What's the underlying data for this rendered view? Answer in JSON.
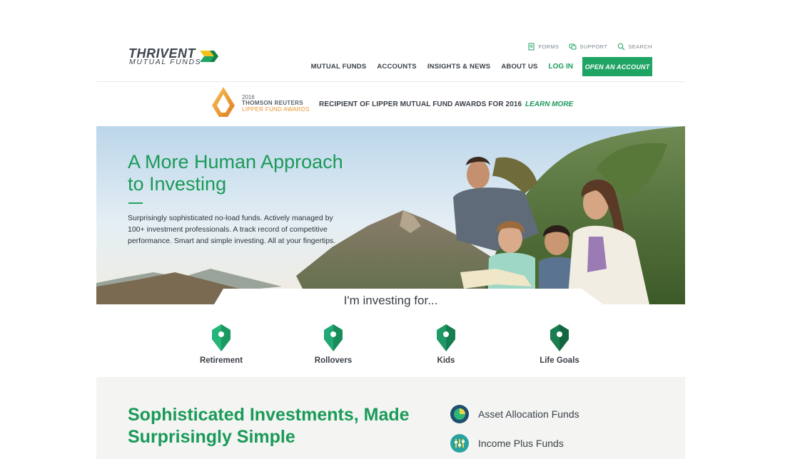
{
  "brand": {
    "name": "THRIVENT",
    "sub": "MUTUAL FUNDS"
  },
  "utility": [
    {
      "label": "FORMS",
      "icon": "document-icon"
    },
    {
      "label": "SUPPORT",
      "icon": "chat-icon"
    },
    {
      "label": "SEARCH",
      "icon": "search-icon"
    }
  ],
  "nav": {
    "items": [
      "MUTUAL FUNDS",
      "ACCOUNTS",
      "INSIGHTS & NEWS",
      "ABOUT US"
    ],
    "login": "LOG IN",
    "cta": "OPEN AN ACCOUNT"
  },
  "award": {
    "year": "2016",
    "org": "THOMSON REUTERS",
    "name": "LIPPER FUND AWARDS",
    "text": "RECIPIENT OF LIPPER MUTUAL FUND AWARDS FOR 2016",
    "link": "LEARN MORE"
  },
  "hero": {
    "title": "A More Human Approach to Investing",
    "body": "Surprisingly sophisticated no-load funds. Actively managed by 100+ investment professionals. A track record of competitive performance. Smart and simple investing. All at your fingertips."
  },
  "investing": {
    "title": "I'm investing for...",
    "goals": [
      "Retirement",
      "Rollovers",
      "Kids",
      "Life Goals"
    ]
  },
  "band": {
    "title": "Sophisticated Investments, Made Surprisingly Simple",
    "funds": [
      "Asset Allocation Funds",
      "Income Plus Funds"
    ]
  },
  "colors": {
    "accent": "#1fa463",
    "heading": "#1a9a58",
    "award": "#e9952c",
    "text": "#3a4047"
  }
}
